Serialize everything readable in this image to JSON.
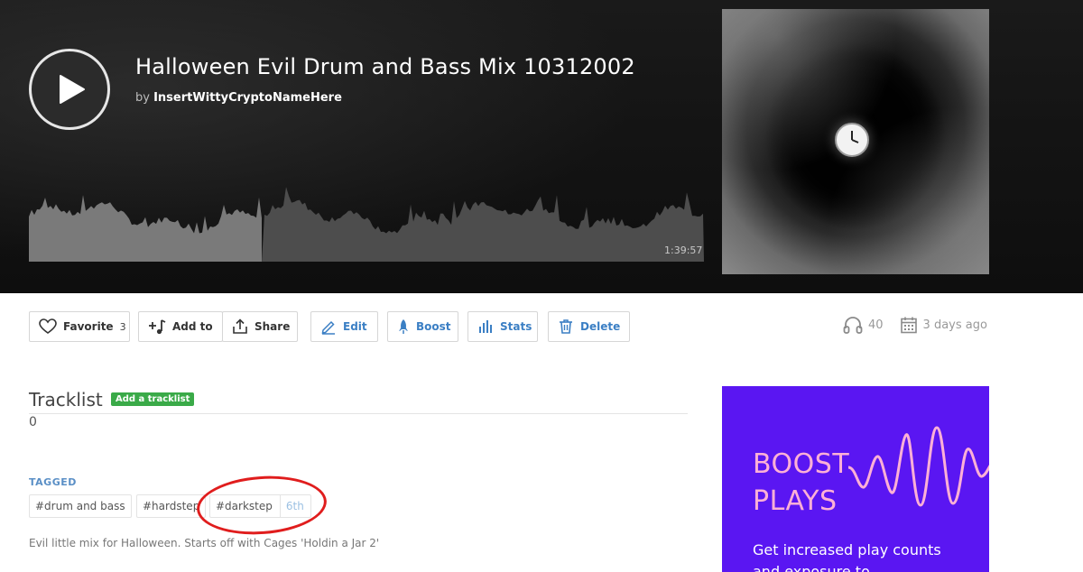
{
  "header": {
    "title": "Halloween Evil Drum and Bass Mix 10312002",
    "by_label": "by",
    "artist": "InsertWittyCryptoNameHere",
    "duration": "1:39:57",
    "play_progress": 0.345
  },
  "actions": {
    "favorite_label": "Favorite",
    "favorite_count": "3",
    "add_to_label": "Add to",
    "share_label": "Share",
    "edit_label": "Edit",
    "boost_label": "Boost",
    "stats_label": "Stats",
    "delete_label": "Delete"
  },
  "stats": {
    "listens": "40",
    "posted": "3 days ago"
  },
  "tracklist": {
    "heading": "Tracklist",
    "add_button": "Add a tracklist",
    "count": "0"
  },
  "tags": {
    "label": "TAGGED",
    "items": [
      {
        "name": "#drum and bass"
      },
      {
        "name": "#hardstep"
      },
      {
        "name": "#darkstep",
        "rank": "6th"
      }
    ]
  },
  "description": "Evil little mix for Halloween. Starts off with Cages 'Holdin a Jar 2'",
  "boost_ad": {
    "title_line1": "BOOST",
    "title_line2": "PLAYS",
    "subtitle": "Get increased play counts and exposure to"
  },
  "colors": {
    "accent_blue": "#3b7fc4",
    "add_tracklist_green": "#3aaa48",
    "boost_bg": "#5a16f2",
    "boost_pink": "#ffb0d6",
    "highlight_red": "#e01d1d"
  }
}
